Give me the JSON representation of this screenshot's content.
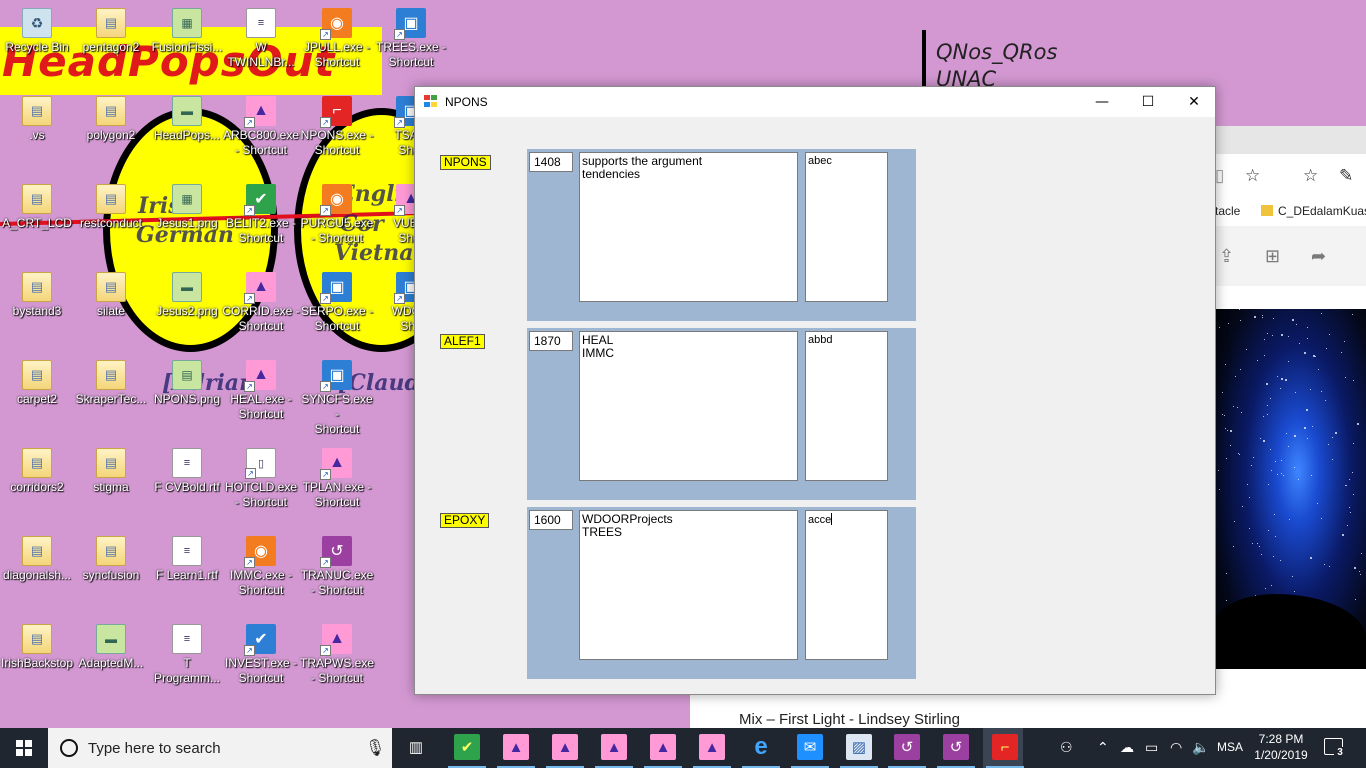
{
  "wallpaper": {
    "banner_text": "HeadPopsOut",
    "oval_left_words": [
      "Irish",
      "German"
    ],
    "oval_right_words": [
      "Englis",
      "Cor",
      "Vietnam"
    ],
    "lower_words": [
      "[Adrian",
      "[Claud"
    ],
    "note_lines": [
      "QNos_QRos",
      "UNAC"
    ]
  },
  "desktop_icons": [
    {
      "label": "Recycle Bin",
      "glyph": "♻",
      "icon": "recycle-bin",
      "kind": "g-bin",
      "shortcut": false,
      "col": 0,
      "row": 0
    },
    {
      "label": "pentagon2",
      "glyph": "▤",
      "icon": "folder",
      "kind": "g-folder",
      "shortcut": false,
      "col": 1,
      "row": 0
    },
    {
      "label": "FusionFissi...",
      "glyph": "▦",
      "icon": "image-file",
      "kind": "g-img",
      "shortcut": false,
      "col": 2,
      "row": 0
    },
    {
      "label": "W\nTWINLNBr...",
      "glyph": "≡",
      "icon": "document-file",
      "kind": "g-file",
      "shortcut": false,
      "col": 3,
      "row": 0
    },
    {
      "label": "JPULL.exe -\nShortcut",
      "glyph": "◉",
      "icon": "app-exe",
      "kind": "g-exe-orange",
      "shortcut": true,
      "col": 4,
      "row": 0
    },
    {
      "label": "TREES.exe -\nShortcut",
      "glyph": "▣",
      "icon": "app-exe",
      "kind": "g-exe-blue",
      "shortcut": true,
      "col": 5,
      "row": 0
    },
    {
      "label": ".vs",
      "glyph": "▤",
      "icon": "folder",
      "kind": "g-folder",
      "shortcut": false,
      "col": 0,
      "row": 1
    },
    {
      "label": "polygon2",
      "glyph": "▤",
      "icon": "folder",
      "kind": "g-folder",
      "shortcut": false,
      "col": 1,
      "row": 1
    },
    {
      "label": "HeadPops...",
      "glyph": "▬",
      "icon": "image-file",
      "kind": "g-img",
      "shortcut": false,
      "col": 2,
      "row": 1
    },
    {
      "label": "ARBC800.exe\n- Shortcut",
      "glyph": "▲",
      "icon": "app-exe",
      "kind": "g-exe-pink",
      "shortcut": true,
      "col": 3,
      "row": 1
    },
    {
      "label": "NPONS.exe -\nShortcut",
      "glyph": "⌐",
      "icon": "app-exe",
      "kind": "g-exe-red",
      "shortcut": true,
      "col": 4,
      "row": 1
    },
    {
      "label": "TSA.e\nShor",
      "glyph": "▣",
      "icon": "app-exe",
      "kind": "g-exe-blue",
      "shortcut": true,
      "col": 5,
      "row": 1
    },
    {
      "label": "A_CRT_LCD",
      "glyph": "▤",
      "icon": "folder",
      "kind": "g-folder",
      "shortcut": false,
      "col": 0,
      "row": 2
    },
    {
      "label": "restconduct",
      "glyph": "▤",
      "icon": "folder",
      "kind": "g-folder",
      "shortcut": false,
      "col": 1,
      "row": 2
    },
    {
      "label": "Jesus1.png",
      "glyph": "▦",
      "icon": "image-file",
      "kind": "g-img",
      "shortcut": false,
      "col": 2,
      "row": 2
    },
    {
      "label": "BELIT2.exe -\nShortcut",
      "glyph": "✔",
      "icon": "app-exe",
      "kind": "g-exe-green",
      "shortcut": true,
      "col": 3,
      "row": 2
    },
    {
      "label": "PURGU5.exe\n- Shortcut",
      "glyph": "◉",
      "icon": "app-exe",
      "kind": "g-exe-orange",
      "shortcut": true,
      "col": 4,
      "row": 2
    },
    {
      "label": "VUEX.\nShor",
      "glyph": "▲",
      "icon": "app-exe",
      "kind": "g-exe-pink",
      "shortcut": true,
      "col": 5,
      "row": 2
    },
    {
      "label": "bystand3",
      "glyph": "▤",
      "icon": "folder",
      "kind": "g-folder",
      "shortcut": false,
      "col": 0,
      "row": 3
    },
    {
      "label": "silate",
      "glyph": "▤",
      "icon": "folder",
      "kind": "g-folder",
      "shortcut": false,
      "col": 1,
      "row": 3
    },
    {
      "label": "Jesus2.png",
      "glyph": "▬",
      "icon": "image-file",
      "kind": "g-img",
      "shortcut": false,
      "col": 2,
      "row": 3
    },
    {
      "label": "CORRID.exe -\nShortcut",
      "glyph": "▲",
      "icon": "app-exe",
      "kind": "g-exe-pink",
      "shortcut": true,
      "col": 3,
      "row": 3
    },
    {
      "label": "SERPO.exe -\nShortcut",
      "glyph": "▣",
      "icon": "app-exe",
      "kind": "g-exe-blue",
      "shortcut": true,
      "col": 4,
      "row": 3
    },
    {
      "label": "WDOO\nSho",
      "glyph": "▣",
      "icon": "app-exe",
      "kind": "g-exe-blue",
      "shortcut": true,
      "col": 5,
      "row": 3
    },
    {
      "label": "carpet2",
      "glyph": "▤",
      "icon": "folder",
      "kind": "g-folder",
      "shortcut": false,
      "col": 0,
      "row": 4
    },
    {
      "label": "SkraperTec...",
      "glyph": "▤",
      "icon": "folder",
      "kind": "g-folder",
      "shortcut": false,
      "col": 1,
      "row": 4
    },
    {
      "label": "NPONS.png",
      "glyph": "▤",
      "icon": "image-file",
      "kind": "g-img",
      "shortcut": false,
      "col": 2,
      "row": 4
    },
    {
      "label": "HEAL.exe -\nShortcut",
      "glyph": "▲",
      "icon": "app-exe",
      "kind": "g-exe-pink",
      "shortcut": true,
      "col": 3,
      "row": 4
    },
    {
      "label": "SYNCFS.exe -\nShortcut",
      "glyph": "▣",
      "icon": "app-exe",
      "kind": "g-exe-blue",
      "shortcut": true,
      "col": 4,
      "row": 4
    },
    {
      "label": "corridors2",
      "glyph": "▤",
      "icon": "folder",
      "kind": "g-folder",
      "shortcut": false,
      "col": 0,
      "row": 5
    },
    {
      "label": "stigma",
      "glyph": "▤",
      "icon": "folder",
      "kind": "g-folder",
      "shortcut": false,
      "col": 1,
      "row": 5
    },
    {
      "label": "F CVBold.rtf",
      "glyph": "≡",
      "icon": "document-file",
      "kind": "g-file",
      "shortcut": false,
      "col": 2,
      "row": 5
    },
    {
      "label": "HOTCLD.exe\n- Shortcut",
      "glyph": "▯",
      "icon": "document-file",
      "kind": "g-file",
      "shortcut": true,
      "col": 3,
      "row": 5
    },
    {
      "label": "TPLAN.exe -\nShortcut",
      "glyph": "▲",
      "icon": "app-exe",
      "kind": "g-exe-pink",
      "shortcut": true,
      "col": 4,
      "row": 5
    },
    {
      "label": "diagonalsh...",
      "glyph": "▤",
      "icon": "folder",
      "kind": "g-folder",
      "shortcut": false,
      "col": 0,
      "row": 6
    },
    {
      "label": "syncfusion",
      "glyph": "▤",
      "icon": "folder",
      "kind": "g-folder",
      "shortcut": false,
      "col": 1,
      "row": 6
    },
    {
      "label": "F Learn1.rtf",
      "glyph": "≡",
      "icon": "document-file",
      "kind": "g-file",
      "shortcut": false,
      "col": 2,
      "row": 6
    },
    {
      "label": "IMMC.exe -\nShortcut",
      "glyph": "◉",
      "icon": "app-exe",
      "kind": "g-exe-orange",
      "shortcut": true,
      "col": 3,
      "row": 6
    },
    {
      "label": "TRANUC.exe\n- Shortcut",
      "glyph": "↺",
      "icon": "app-exe",
      "kind": "g-exe-purple",
      "shortcut": true,
      "col": 4,
      "row": 6
    },
    {
      "label": "IrishBackstop",
      "glyph": "▤",
      "icon": "folder",
      "kind": "g-folder",
      "shortcut": false,
      "col": 0,
      "row": 7
    },
    {
      "label": "AdaptedM...",
      "glyph": "▬",
      "icon": "image-file",
      "kind": "g-img",
      "shortcut": false,
      "col": 1,
      "row": 7
    },
    {
      "label": "T\nProgramm...",
      "glyph": "≡",
      "icon": "document-file",
      "kind": "g-file",
      "shortcut": false,
      "col": 2,
      "row": 7
    },
    {
      "label": "INVEST.exe -\nShortcut",
      "glyph": "✔",
      "icon": "app-exe",
      "kind": "g-exe-blue",
      "shortcut": true,
      "col": 3,
      "row": 7
    },
    {
      "label": "TRAPWS.exe\n- Shortcut",
      "glyph": "▲",
      "icon": "app-exe",
      "kind": "g-exe-pink",
      "shortcut": true,
      "col": 4,
      "row": 7
    }
  ],
  "browser": {
    "favorites": [
      "ctacle",
      "C_DEdalamKuas"
    ],
    "caption": "Mix – First Light - Lindsey Stirling"
  },
  "window": {
    "title": "NPONS",
    "minimize_glyph": "—",
    "maximize_glyph": "☐",
    "close_glyph": "✕",
    "rows": [
      {
        "label": "NPONS",
        "number": "1408",
        "lines": [
          "supports the argument",
          "tendencies"
        ],
        "code": "abec",
        "caret": false
      },
      {
        "label": "ALEF1",
        "number": "1870",
        "lines": [
          "HEAL",
          "IMMC"
        ],
        "code": "abbd",
        "caret": false
      },
      {
        "label": "EPOXY",
        "number": "1600",
        "lines": [
          "WDOORProjects",
          "TREES"
        ],
        "code": "acce",
        "caret": true
      }
    ]
  },
  "taskbar": {
    "search_placeholder": "Type here to search",
    "apps": [
      {
        "name": "task-view-icon",
        "glyph": "▥",
        "bg": "transparent",
        "color": "#ffffff"
      },
      {
        "name": "belit-app-icon",
        "glyph": "✔",
        "bg": "#2ea34c",
        "color": "#ffff66"
      },
      {
        "name": "purple-app-icon-1",
        "glyph": "▲",
        "bg": "#ff9ad6",
        "color": "#4527a0"
      },
      {
        "name": "purple-app-icon-2",
        "glyph": "▲",
        "bg": "#ff9ad6",
        "color": "#4527a0"
      },
      {
        "name": "purple-app-icon-3",
        "glyph": "▲",
        "bg": "#ff9ad6",
        "color": "#4527a0"
      },
      {
        "name": "purple-app-icon-4",
        "glyph": "▲",
        "bg": "#ff9ad6",
        "color": "#4527a0"
      },
      {
        "name": "purple-app-icon-5",
        "glyph": "▲",
        "bg": "#ff9ad6",
        "color": "#4527a0"
      },
      {
        "name": "edge-browser-icon",
        "glyph": "e",
        "bg": "transparent",
        "color": "#3ea6ff"
      },
      {
        "name": "messenger-icon",
        "glyph": "✉",
        "bg": "#1e90ff",
        "color": "#ffffff"
      },
      {
        "name": "photos-app-icon",
        "glyph": "▨",
        "bg": "#dde7f4",
        "color": "#3366aa"
      },
      {
        "name": "tranuc-app-icon-1",
        "glyph": "↺",
        "bg": "#9b3fa1",
        "color": "#ffffff"
      },
      {
        "name": "tranuc-app-icon-2",
        "glyph": "↺",
        "bg": "#9b3fa1",
        "color": "#ffffff"
      },
      {
        "name": "npons-app-icon",
        "glyph": "⌐",
        "bg": "#e42525",
        "color": "#ffff66"
      }
    ],
    "language": "MSA",
    "time": "7:28 PM",
    "date": "1/20/2019",
    "notification_count": "3"
  }
}
